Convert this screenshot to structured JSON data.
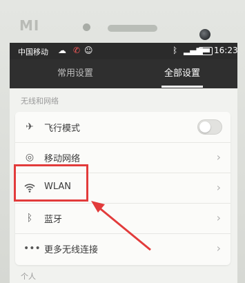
{
  "device": {
    "brand": "MI"
  },
  "status_bar": {
    "carrier": "中国移动",
    "time": "16:23"
  },
  "tabs": [
    {
      "label": "常用设置",
      "active": false
    },
    {
      "label": "全部设置",
      "active": true
    }
  ],
  "sections": [
    {
      "label": "无线和网络",
      "items": [
        {
          "label": "飞行模式",
          "icon": "airplane-icon",
          "control": "toggle",
          "value": "off"
        },
        {
          "label": "移动网络",
          "icon": "mobile-network-icon",
          "control": "chevron"
        },
        {
          "label": "WLAN",
          "icon": "wifi-icon",
          "control": "chevron",
          "highlighted": true
        },
        {
          "label": "蓝牙",
          "icon": "bluetooth-icon",
          "control": "chevron"
        },
        {
          "label": "更多无线连接",
          "icon": "more-icon",
          "control": "chevron"
        }
      ]
    },
    {
      "label": "个人",
      "items": []
    }
  ],
  "colors": {
    "annotation_red": "#e23b3b",
    "status_bar_bg": "#2b2b2b",
    "list_bg": "#fbfbf9"
  }
}
